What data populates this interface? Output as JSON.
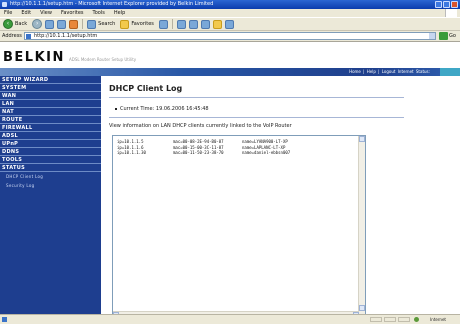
{
  "window": {
    "title": "http://10.1.1.1/setup.htm - Microsoft Internet Explorer provided by Belkin Limited"
  },
  "menu": [
    "File",
    "Edit",
    "View",
    "Favorites",
    "Tools",
    "Help"
  ],
  "toolbar": {
    "back_label": "Back",
    "search_label": "Search",
    "favorites_label": "Favorites"
  },
  "address": {
    "label": "Address",
    "url": "http://10.1.1.1/setup.htm",
    "go_label": "Go"
  },
  "brand": {
    "logo": "BELKIN",
    "subtitle": "ADSL Modem Router Setup Utility"
  },
  "topnav": {
    "links": "Home | Help | Logout   Internet Status:"
  },
  "sidebar": {
    "items": [
      "SETUP WIZARD",
      "SYSTEM",
      "WAN",
      "LAN",
      "NAT",
      "ROUTE",
      "FIREWALL",
      "ADSL",
      "UPnP",
      "DDNS",
      "TOOLS",
      "STATUS"
    ],
    "sub_items": [
      "DHCP Client Log",
      "Security Log"
    ]
  },
  "main": {
    "title": "DHCP Client Log",
    "current_time_label": "Current Time",
    "current_time": "19.06.2006 16:45:48",
    "info": "View information on LAN DHCP clients currently linked to the VoIP Router",
    "log_rows": [
      [
        "ip=10.1.1.5",
        "mac=00-08-2E-94-B0-87",
        "name=LYANA900-LT-XP"
      ],
      [
        "ip=10.1.1.6",
        "mac=00-15-00-3C-11-87",
        "name=LAPLANC-LT-XP"
      ],
      [
        "ip=10.1.1.30",
        "mac=00-11-50-23-38-70",
        "name=daniel-ebbsn007"
      ]
    ]
  },
  "status": {
    "zone": "Internet"
  }
}
